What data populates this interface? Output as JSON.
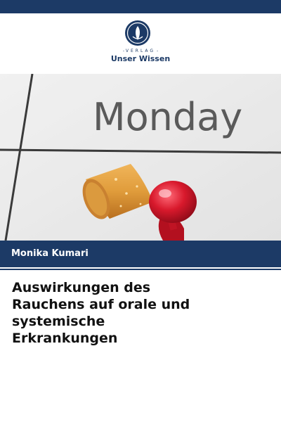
{
  "publisher": {
    "tagline": "VERLAG",
    "name": "Unser Wissen"
  },
  "photo": {
    "calendar_word": "Monday"
  },
  "author": {
    "name": "Monika Kumari"
  },
  "title": {
    "lines": [
      "Auswirkungen des",
      "Rauchens auf orale und",
      "systemische",
      "Erkrankungen"
    ]
  },
  "colors": {
    "brand": "#1c3a66",
    "pin": "#d8192c",
    "filter": "#e3a545"
  }
}
